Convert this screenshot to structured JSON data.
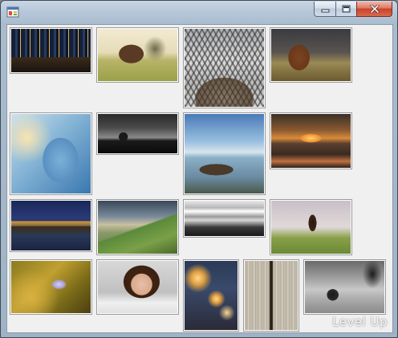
{
  "window": {
    "caption_buttons": [
      {
        "name": "minimize-button",
        "icon": "minimize-icon"
      },
      {
        "name": "maximize-button",
        "icon": "maximize-icon"
      },
      {
        "name": "close-button",
        "icon": "close-icon"
      }
    ]
  },
  "gallery": {
    "thumbnails": [
      {
        "name": "thumb-city-skyline-night"
      },
      {
        "name": "thumb-barn-field"
      },
      {
        "name": "thumb-eiffel-tower"
      },
      {
        "name": "thumb-dog-sunset"
      },
      {
        "name": "thumb-silhouette-head-tree"
      },
      {
        "name": "thumb-lone-tree-horizon"
      },
      {
        "name": "thumb-boat-lake"
      },
      {
        "name": "thumb-sunset-pier"
      },
      {
        "name": "thumb-london-night"
      },
      {
        "name": "thumb-green-hills"
      },
      {
        "name": "thumb-misty-valley"
      },
      {
        "name": "thumb-girl-jumping"
      },
      {
        "name": "thumb-flower-bokeh"
      },
      {
        "name": "thumb-woman-portrait"
      },
      {
        "name": "thumb-street-lamps"
      },
      {
        "name": "thumb-wooden-door"
      },
      {
        "name": "thumb-cyclist-street"
      }
    ]
  },
  "watermark": "Level Up"
}
